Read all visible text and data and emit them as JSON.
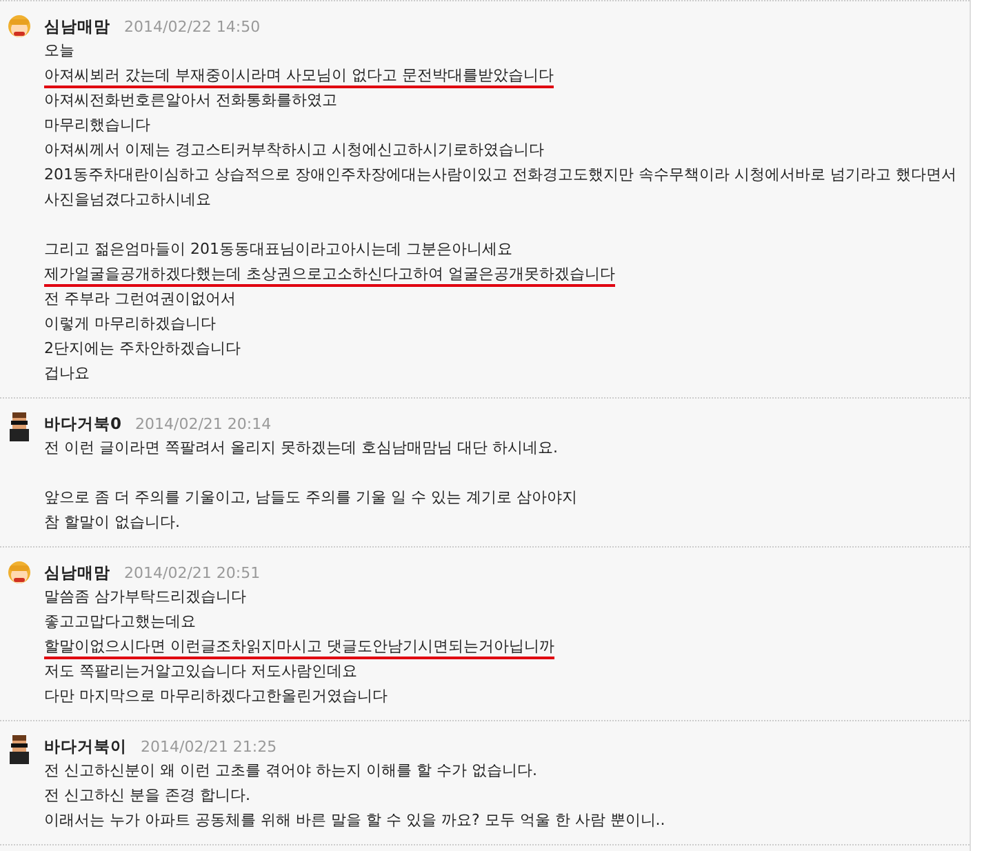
{
  "comments": [
    {
      "author": "심남매맘",
      "kind": "girl",
      "date": "2014/02/22 14:50",
      "paragraphs": [
        [
          {
            "text": "오늘",
            "underlined": false
          },
          {
            "text": "아져씨뵈러 갔는데 부재중이시라며 사모님이 없다고 문전박대를받았습니다",
            "underlined": true
          },
          {
            "text": "아져씨전화번호른알아서 전화통화를하였고",
            "underlined": false
          },
          {
            "text": "마무리했습니다",
            "underlined": false
          },
          {
            "text": "아져씨께서 이제는 경고스티커부착하시고 시청에신고하시기로하였습니다",
            "underlined": false
          },
          {
            "text": "201동주차대란이심하고 상습적으로 장애인주차장에대는사람이있고 전화경고도했지만 속수무책이라 시청에서바로 넘기라고 했다면서 사진을넘겼다고하시네요",
            "underlined": false
          }
        ],
        [
          {
            "text": "그리고 젊은엄마들이 201동동대표님이라고아시는데 그분은아니세요",
            "underlined": false
          },
          {
            "text": "제가얼굴을공개하겠다했는데 초상권으로고소하신다고하여 얼굴은공개못하겠습니다",
            "underlined": true
          },
          {
            "text": "전 주부라 그런여권이없어서",
            "underlined": false
          },
          {
            "text": "이렇게 마무리하겠습니다",
            "underlined": false
          },
          {
            "text": "2단지에는 주차안하겠습니다",
            "underlined": false
          },
          {
            "text": "겁나요",
            "underlined": false
          }
        ]
      ]
    },
    {
      "author": "바다거북0",
      "kind": "man",
      "date": "2014/02/21 20:14",
      "paragraphs": [
        [
          {
            "text": "전 이런 글이라면 쪽팔려서 올리지 못하겠는데 호심남매맘님 대단 하시네요.",
            "underlined": false
          }
        ],
        [
          {
            "text": "앞으로 좀 더 주의를 기울이고, 남들도 주의를 기울 일 수 있는 계기로 삼아야지",
            "underlined": false
          },
          {
            "text": "참 할말이 없습니다.",
            "underlined": false
          }
        ]
      ]
    },
    {
      "author": "심남매맘",
      "kind": "girl",
      "date": "2014/02/21 20:51",
      "paragraphs": [
        [
          {
            "text": "말씀좀 삼가부탁드리겠습니다",
            "underlined": false
          },
          {
            "text": "좋고고맙다고했는데요",
            "underlined": false
          },
          {
            "text": "할말이없으시다면 이런글조차읽지마시고 댓글도안남기시면되는거아닙니까",
            "underlined": true
          },
          {
            "text": "저도 쪽팔리는거알고있습니다 저도사람인데요",
            "underlined": false
          },
          {
            "text": "다만 마지막으로 마무리하겠다고한올린거였습니다",
            "underlined": false
          }
        ]
      ]
    },
    {
      "author": "바다거북이",
      "kind": "man",
      "date": "2014/02/21 21:25",
      "paragraphs": [
        [
          {
            "text": "전 신고하신분이 왜 이런 고초를 겪어야 하는지 이해를 할 수가 없습니다.",
            "underlined": false
          },
          {
            "text": "전 신고하신 분을 존경 합니다.",
            "underlined": false
          },
          {
            "text": "이래서는 누가 아파트 공동체를 위해 바른 말을 할 수 있을 까요? 모두 억울 한 사람 뿐이니..",
            "underlined": false
          }
        ]
      ]
    }
  ]
}
